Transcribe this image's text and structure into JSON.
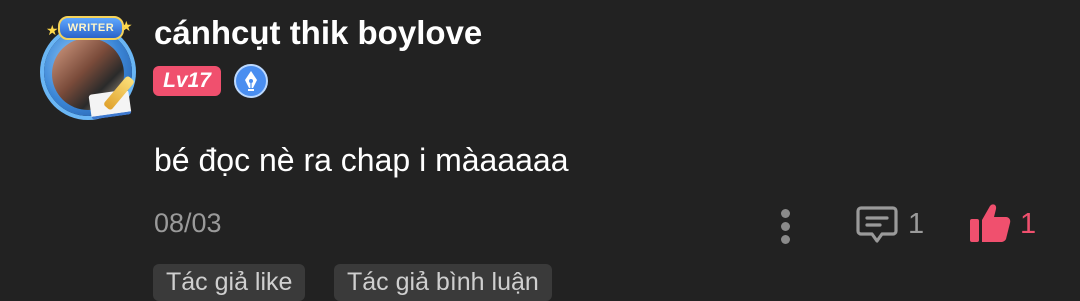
{
  "user": {
    "name": "cánhcụt thik boylove",
    "level": "Lv17",
    "avatar_banner": "WRITER",
    "writer_badge_icon": "fountain-pen-icon"
  },
  "comment": {
    "text": "bé đọc nè ra chap i màaaaaa",
    "date": "08/03"
  },
  "actions": {
    "more_icon": "vertical-dots-icon",
    "reply_icon": "comment-icon",
    "reply_count": "1",
    "like_icon": "thumbs-up-icon",
    "like_count": "1"
  },
  "tags": {
    "author_liked": "Tác giả like",
    "author_replied": "Tác giả bình luận"
  },
  "colors": {
    "background": "#222222",
    "accent": "#f0506e",
    "muted": "#9a9a9a",
    "tag_bg": "#3a3a3a"
  }
}
